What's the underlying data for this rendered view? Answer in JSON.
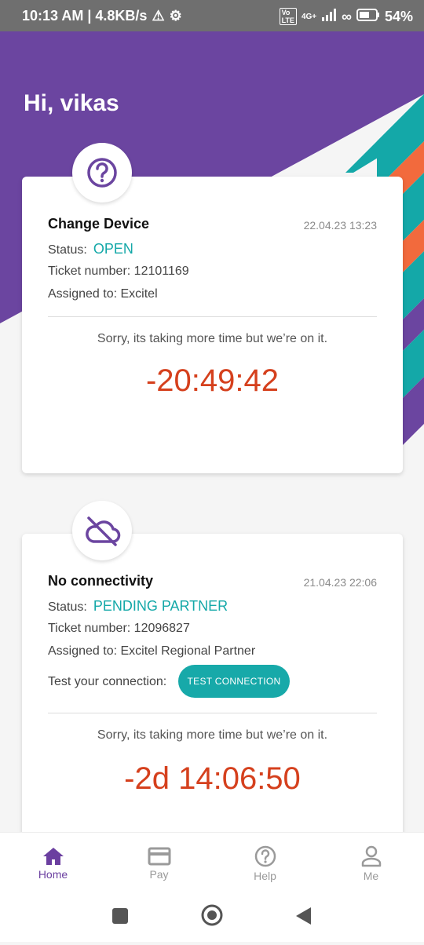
{
  "status_bar": {
    "time_speed": "10:13 AM | 4.8KB/s",
    "network_label": "4G+",
    "battery": "54%"
  },
  "greeting": "Hi, vikas",
  "tickets": [
    {
      "title": "Change Device",
      "date": "22.04.23 13:23",
      "status_label": "Status:",
      "status": "OPEN",
      "ticket_number": "Ticket number: 12101169",
      "assigned": "Assigned to: Excitel",
      "message": "Sorry, its taking more time but we’re on it.",
      "timer": "-20:49:42",
      "icon": "question-circle-icon"
    },
    {
      "title": "No connectivity",
      "date": "21.04.23 22:06",
      "status_label": "Status:",
      "status": "PENDING PARTNER",
      "ticket_number": "Ticket number: 12096827",
      "assigned": "Assigned to: Excitel Regional Partner",
      "test_label": "Test your connection:",
      "test_button": "TEST CONNECTION",
      "message": "Sorry, its taking more time but we’re on it.",
      "timer": "-2d 14:06:50",
      "icon": "cloud-off-icon"
    }
  ],
  "nav": {
    "home": "Home",
    "pay": "Pay",
    "help": "Help",
    "me": "Me"
  },
  "colors": {
    "brand_purple": "#6b45a0",
    "teal": "#14a8a8",
    "orange": "#f26a3d",
    "timer_red": "#d5401d"
  }
}
